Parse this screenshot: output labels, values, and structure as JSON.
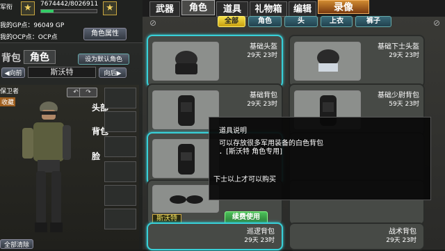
{
  "player": {
    "rank_name": "军衔",
    "exp": "7674442/8026911",
    "gp": "我的GP点：96049 GP",
    "ocp": "我的OCP点：OCP点",
    "role_attr_btn": "角色属性"
  },
  "left_tabs": {
    "bag": "背包",
    "role": "角色",
    "set_default": "设为默认角色"
  },
  "char_nav": {
    "prev": "向前",
    "name": "斯沃特",
    "next": "向后"
  },
  "char_tags": {
    "guardian": "保卫者",
    "collect": "收藏"
  },
  "equip_slots": {
    "head": "头部",
    "back": "背包",
    "face": "脸"
  },
  "footer_left": "全部清除",
  "top_tabs": [
    "武器",
    "角色",
    "道具",
    "礼物箱",
    "编辑",
    "录像"
  ],
  "filters": [
    "全部",
    "角色",
    "头",
    "上衣",
    "裤子"
  ],
  "items": [
    {
      "name": "基础头盔",
      "time": "29天 23时"
    },
    {
      "name": "基础下士头盔",
      "time": "29天 23时"
    },
    {
      "name": "基础背包",
      "time": "29天 23时"
    },
    {
      "name": "基础少尉背包",
      "time": "59天 23时"
    },
    {
      "name": "",
      "time": ""
    },
    {
      "name": "",
      "time": ""
    },
    {
      "name": "斯沃特",
      "time": ""
    },
    {
      "name": "",
      "time": ""
    },
    {
      "name": "巡逻背包",
      "time": "29天 23时"
    },
    {
      "name": "战术背包",
      "time": "29天 23时"
    }
  ],
  "renew_btn": "续费使用",
  "tooltip": {
    "title": "道具说明",
    "line1": "可以存放很多军用装备的白色背包",
    "line2": "．[斯沃特 角色专用]",
    "req": "下士以上才可以购买"
  },
  "colors": {
    "accent": "#38d0d8",
    "gold": "#c9a640",
    "renew": "#3aa048"
  }
}
